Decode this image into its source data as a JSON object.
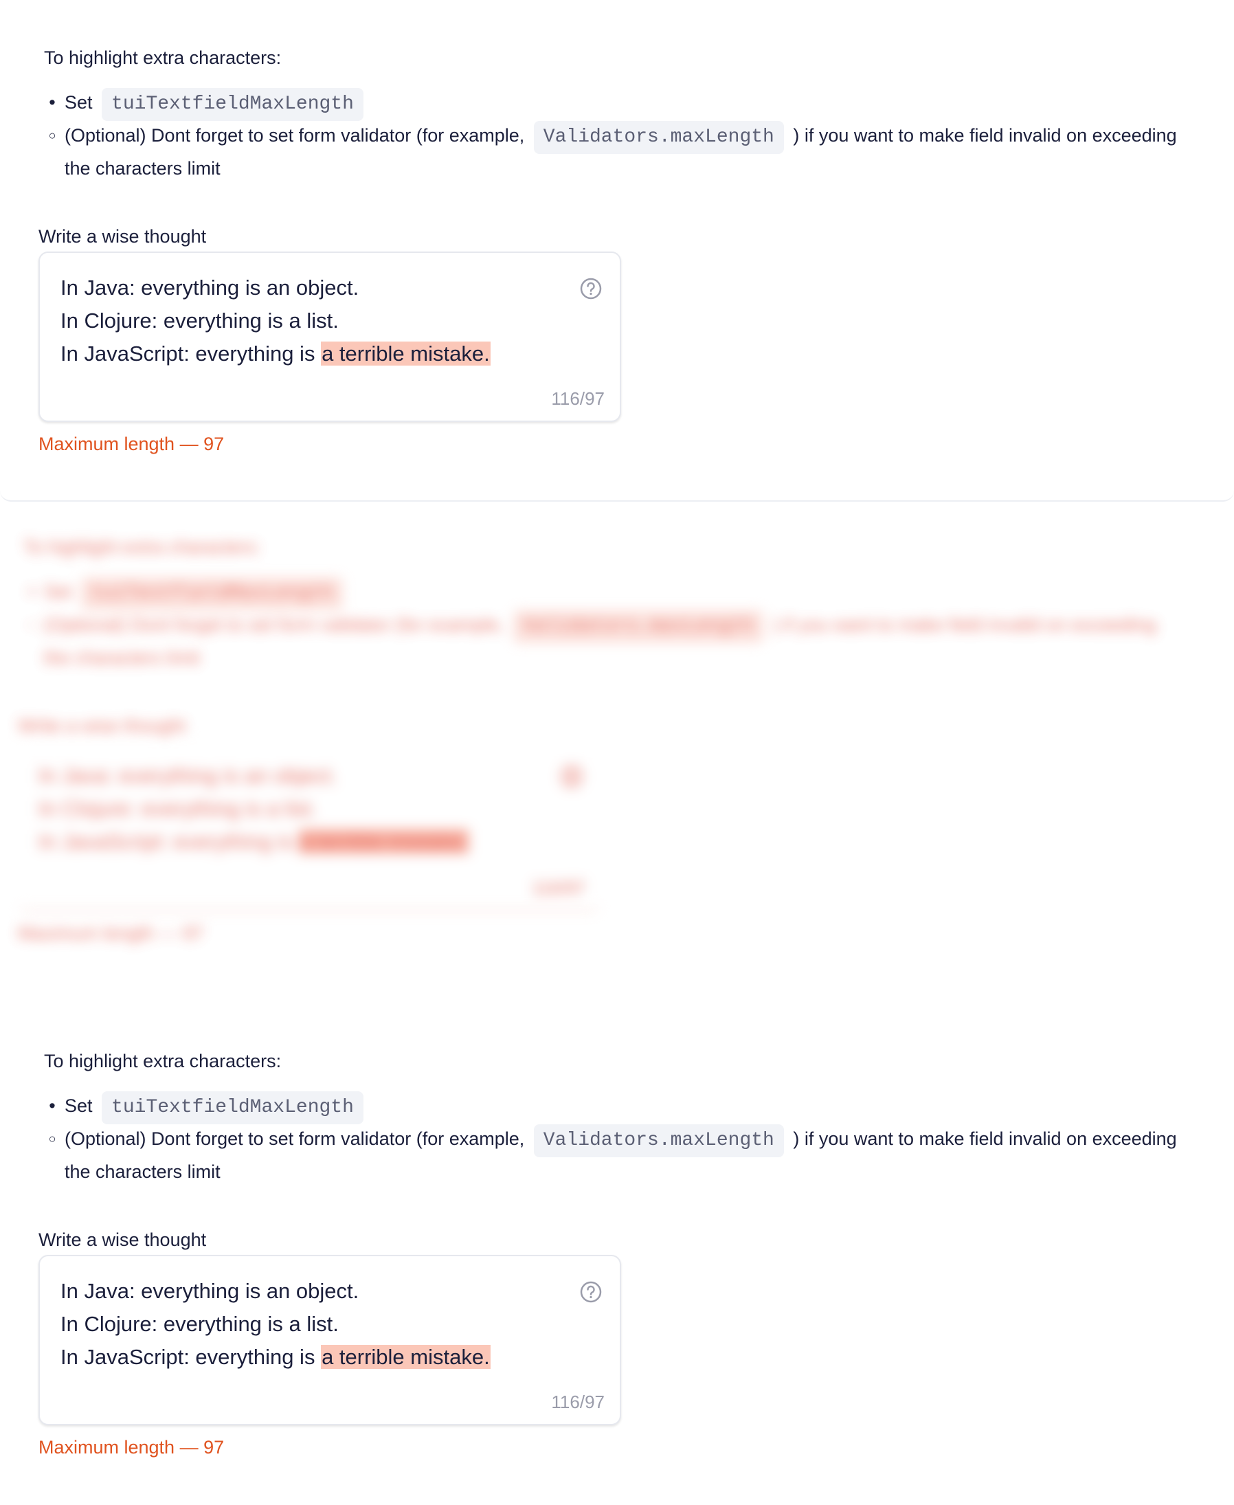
{
  "intro": "To highlight extra characters:",
  "steps": {
    "step1_prefix": "Set",
    "step1_code": "tuiTextfieldMaxLength",
    "step2_prefix": "(Optional) Dont forget to set form validator (for example,",
    "step2_code": "Validators.maxLength",
    "step2_suffix": ") if you want to make field invalid on exceeding the characters limit"
  },
  "field": {
    "label": "Write a wise thought",
    "line1": "In Java: everything is an object.",
    "line2": "In Clojure: everything is a list.",
    "line3_normal": "In JavaScript: everything is ",
    "line3_extra": "a terrible mistake.",
    "counter": "116/97",
    "error": "Maximum length — 97"
  },
  "colors": {
    "error": "#e0531f",
    "highlight": "#fbc7b8",
    "code_bg": "#f1f3f7"
  },
  "icons": {
    "help": "question-circle-icon"
  }
}
